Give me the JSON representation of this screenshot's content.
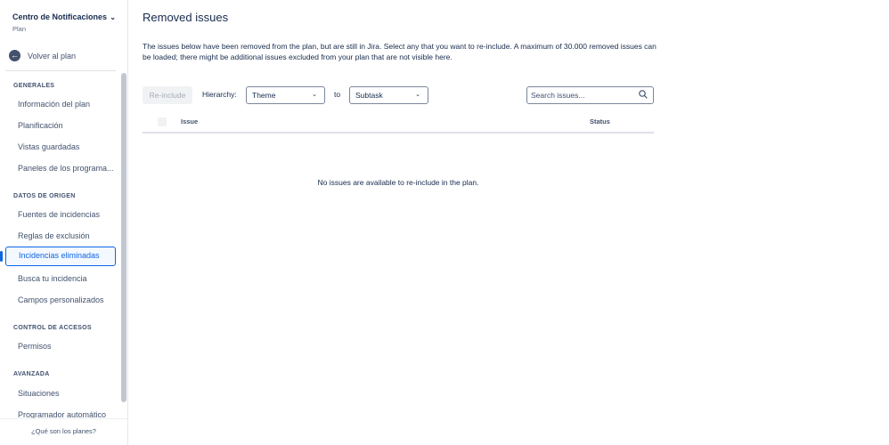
{
  "sidebar": {
    "plan_title": "Centro de Notificaciones",
    "plan_subtitle": "Plan",
    "back_label": "Volver al plan",
    "sections": [
      {
        "title": "GENERALES",
        "items": [
          "Información del plan",
          "Planificación",
          "Vistas guardadas",
          "Paneles de los programa..."
        ]
      },
      {
        "title": "DATOS DE ORIGEN",
        "items": [
          "Fuentes de incidencias",
          "Reglas de exclusión",
          "Incidencias eliminadas",
          "Busca tu incidencia",
          "Campos personalizados"
        ]
      },
      {
        "title": "CONTROL DE ACCESOS",
        "items": [
          "Permisos"
        ]
      },
      {
        "title": "AVANZADA",
        "items": [
          "Situaciones",
          "Programador automático"
        ]
      }
    ],
    "selected_item": "Incidencias eliminadas",
    "footer_link": "¿Qué son los planes?"
  },
  "main": {
    "title": "Removed issues",
    "description": "The issues below have been removed from the plan, but are still in Jira. Select any that you want to re-include. A maximum of 30.000 removed issues can be loaded; there might be additional issues excluded from your plan that are not visible here.",
    "toolbar": {
      "reinclude_label": "Re-include",
      "hierarchy_label": "Hierarchy:",
      "from_value": "Theme",
      "to_label": "to",
      "to_value": "Subtask",
      "search_placeholder": "Search issues..."
    },
    "table": {
      "columns": [
        "Issue",
        "Status"
      ]
    },
    "empty_message": "No issues are available to re-include in the plan."
  },
  "colors": {
    "accent": "#0c66e4",
    "text": "#172b4d",
    "muted": "#42526e"
  }
}
